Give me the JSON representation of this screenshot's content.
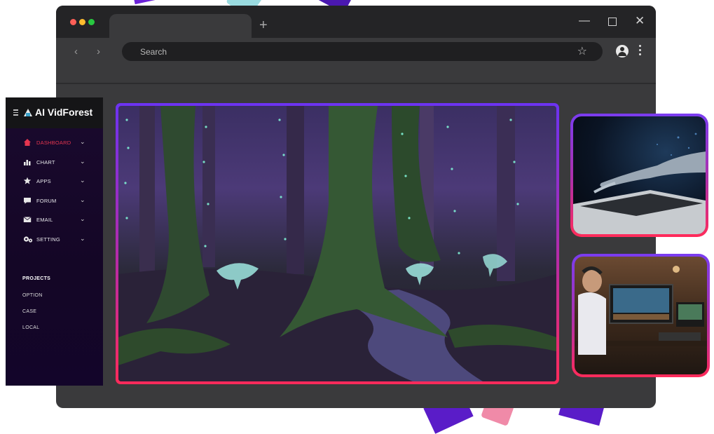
{
  "browser": {
    "new_tab_symbol": "+",
    "search_placeholder": "Search",
    "window_controls": {
      "minimize": "—",
      "maximize": "",
      "close": "✕"
    },
    "nav": {
      "back": "‹",
      "forward": "›"
    }
  },
  "sidebar": {
    "brand": "AI VidForest",
    "menu": [
      {
        "label": "DASHBOARD",
        "icon": "home-icon",
        "active": true
      },
      {
        "label": "CHART",
        "icon": "chart-icon",
        "active": false
      },
      {
        "label": "APPS",
        "icon": "star-icon",
        "active": false
      },
      {
        "label": "FORUM",
        "icon": "chat-icon",
        "active": false
      },
      {
        "label": "EMAIL",
        "icon": "mail-icon",
        "active": false
      },
      {
        "label": "SETTING",
        "icon": "gears-icon",
        "active": false
      }
    ],
    "section_title": "PROJECTS",
    "sub_items": [
      "OPTION",
      "CASE",
      "LOCAL"
    ]
  },
  "colors": {
    "active_menu": "#e5354f",
    "gradient_top": "#6c33f2",
    "gradient_bottom": "#ff2b5a",
    "window_bg": "#3a3a3c",
    "titlebar_bg": "#242426"
  }
}
